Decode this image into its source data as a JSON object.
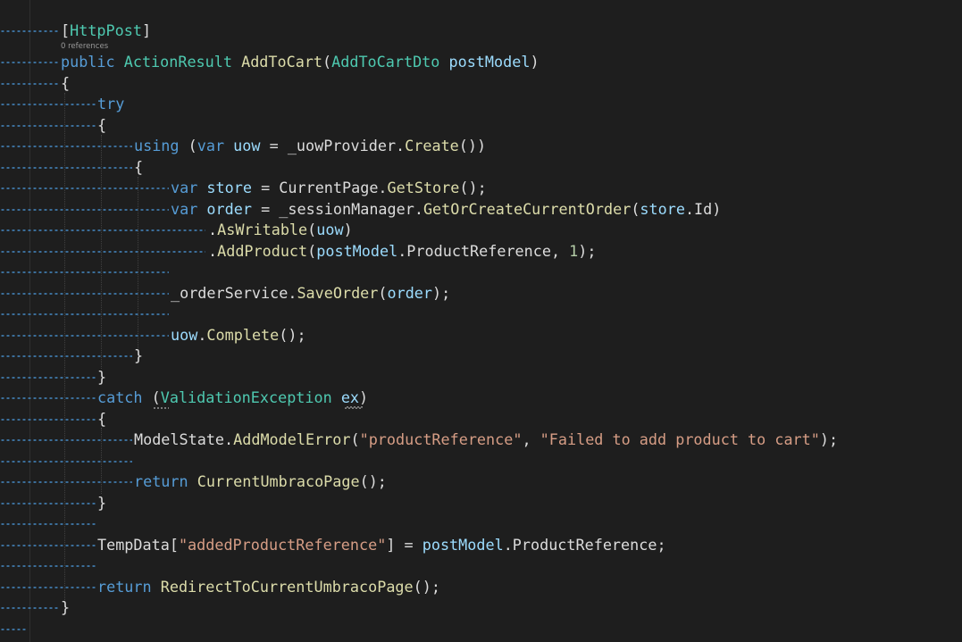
{
  "editor": {
    "lens_text": "0 references",
    "lines": [
      {
        "text": "[HttpPost]"
      },
      {
        "text": "public ActionResult AddToCart(AddToCartDto postModel)"
      },
      {
        "text": "{"
      },
      {
        "text": "try"
      },
      {
        "text": "{"
      },
      {
        "text": "using (var uow = _uowProvider.Create())"
      },
      {
        "text": "{"
      },
      {
        "text": "var store = CurrentPage.GetStore();"
      },
      {
        "text": "var order = _sessionManager.GetOrCreateCurrentOrder(store.Id)"
      },
      {
        "text": ".AsWritable(uow)"
      },
      {
        "text": ".AddProduct(postModel.ProductReference, 1);"
      },
      {
        "text": "_orderService.SaveOrder(order);"
      },
      {
        "text": "uow.Complete();"
      },
      {
        "text": "}"
      },
      {
        "text": "}"
      },
      {
        "text": "catch (ValidationException ex)"
      },
      {
        "text": "{"
      },
      {
        "text": "ModelState.AddModelError(\"productReference\", \"Failed to add product to cart\");"
      },
      {
        "text": "return CurrentUmbracoPage();"
      },
      {
        "text": "}"
      },
      {
        "text": "TempData[\"addedProductReference\"] = postModel.ProductReference;"
      },
      {
        "text": "return RedirectToCurrentUmbracoPage();"
      },
      {
        "text": "}"
      }
    ]
  },
  "colors": {
    "background": "#1e1e1e",
    "keyword": "#569cd6",
    "type": "#4ec9b0",
    "method": "#dcdcaa",
    "string": "#d69d85",
    "number": "#b5cea8",
    "variable": "#9cdcfe",
    "plain": "#dcdcdc",
    "whitespace_dot": "#3b6e9a"
  }
}
